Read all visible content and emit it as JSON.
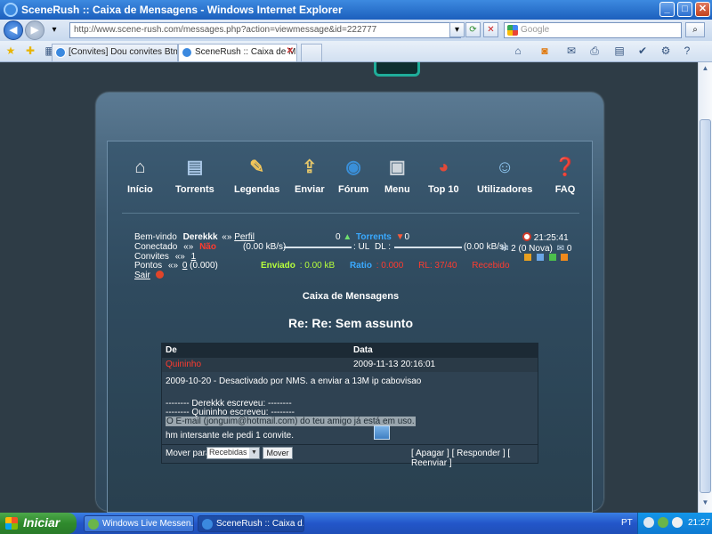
{
  "window": {
    "title": "SceneRush :: Caixa de Mensagens - Windows Internet Explorer"
  },
  "browser": {
    "address": "http://www.scene-rush.com/messages.php?action=viewmessage&id=222777",
    "search_placeholder": "Google",
    "tabs": [
      {
        "label": "[Convites] Dou convites Btne..."
      },
      {
        "label": "SceneRush :: Caixa de M..."
      }
    ]
  },
  "nav": {
    "items": [
      {
        "label": "Início",
        "icon": "home-icon"
      },
      {
        "label": "Torrents",
        "icon": "torrents-icon"
      },
      {
        "label": "Legendas",
        "icon": "subtitles-icon"
      },
      {
        "label": "Enviar",
        "icon": "upload-icon"
      },
      {
        "label": "Fórum",
        "icon": "globe-icon"
      },
      {
        "label": "Menu",
        "icon": "menu-icon"
      },
      {
        "label": "Top 10",
        "icon": "chart-icon"
      },
      {
        "label": "Utilizadores",
        "icon": "users-icon"
      },
      {
        "label": "FAQ",
        "icon": "faq-icon"
      }
    ]
  },
  "user": {
    "welcome_label": "Bem-vindo",
    "username": "Derekkk",
    "profile_sep": "«»",
    "profile_link": "Perfil",
    "connected_label": "Conectado",
    "connected_sep": "«»",
    "connected_value": "Não",
    "invites_label": "Convites",
    "invites_sep": "«»",
    "invites_value": "1",
    "points_label": "Pontos",
    "points_sep": "«»",
    "points_value": "0",
    "points_extra": "(0.000)",
    "logout": "Sair"
  },
  "stats": {
    "seeding_count": "0",
    "seeding_label": "Torrents",
    "leeching_count": "0",
    "ul_rate": "(0.00 kB/s)",
    "ul_label": ": UL",
    "dl_label": "DL :",
    "dl_rate": "(0.00 kB/s)",
    "sent_label": "Enviado",
    "sent_value": ": 0.00 kB",
    "ratio_label": "Ratio",
    "ratio_value": ": 0.000",
    "received_label": "RL: 37/40",
    "downloaded_label": "Recebido"
  },
  "right_panel": {
    "time": "21:25:41",
    "messages": "2 (0 Nova)",
    "sent_count": "0"
  },
  "mailbox": {
    "box_title": "Caixa de Mensagens",
    "subject": "Re: Re: Sem assunto",
    "col_from": "De",
    "col_date": "Data",
    "sender": "Quininho",
    "date": "2009-11-13 20:16:01",
    "body_line1": "2009-10-20 - Desactivado por NMS. a enviar a 13M ip cabovisao",
    "quote_line1": "-------- Derekkk escreveu: --------",
    "quote_line2": "-------- Quininho escreveu: --------",
    "quote_line3": "O E-mail (jonguim@hotmail.com) do teu amigo já está em uso.",
    "reply_line": "hm intersante ele pedi 1 convite.",
    "move_label": "Mover para:",
    "move_option": "Recebidas",
    "move_button": "Mover",
    "actions": "[ Apagar ] [ Responder ] [ Reenviar ]"
  },
  "taskbar": {
    "start_label": "Iniciar",
    "items": [
      {
        "label": "Windows Live Messen..."
      },
      {
        "label": "SceneRush :: Caixa d..."
      }
    ],
    "language": "PT",
    "clock": "21:27"
  },
  "colors": {
    "accent_red": "#ff3b2f",
    "sent_green": "#b7ff3c",
    "ratio_blue": "#3aa9ff",
    "page_bg": "#2e3c46",
    "ie_blue": "#1c5fbd"
  }
}
